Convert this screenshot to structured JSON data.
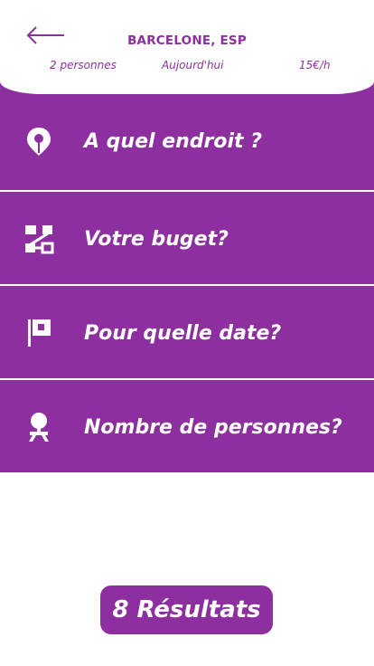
{
  "colors": {
    "accent": "#8e2fa0",
    "background": "#ffffff"
  },
  "header": {
    "back_icon": "arrow-left-icon",
    "title": "BARCELONE, ESP",
    "persons": "2 personnes",
    "date": "Aujourd'hui",
    "price": "15€/h"
  },
  "options": [
    {
      "icon": "map-pin-icon",
      "label": "A quel endroit ?"
    },
    {
      "icon": "budget-flow-icon",
      "label": "Votre buget?"
    },
    {
      "icon": "flag-icon",
      "label": "Pour quelle date?"
    },
    {
      "icon": "person-icon",
      "label": "Nombre de personnes?"
    }
  ],
  "results_button": {
    "label": "8 Résultats"
  }
}
